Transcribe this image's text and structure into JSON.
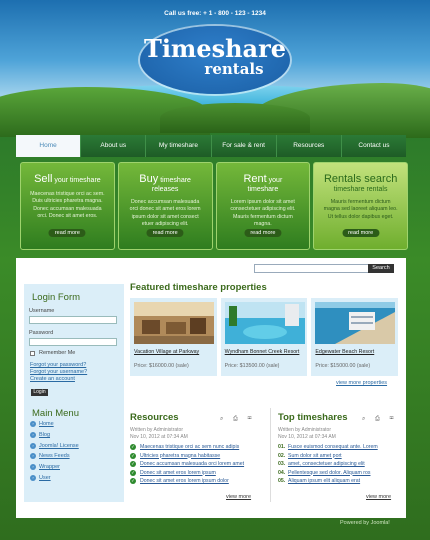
{
  "header": {
    "phone": "Call us free: + 1 - 800 - 123 - 1234",
    "logo_line1": "Timeshare",
    "logo_line2": "rentals"
  },
  "nav": {
    "items": [
      {
        "label": "Home"
      },
      {
        "label": "About us"
      },
      {
        "label": "My timeshare"
      },
      {
        "label": "For sale & rent"
      },
      {
        "label": "Resources"
      },
      {
        "label": "Contact us"
      }
    ]
  },
  "features": [
    {
      "title": "Sell",
      "title_small": " your timeshare",
      "subtitle": "",
      "text": "Maecenas tristique orci ac sem. Duis ultricies pharetra magna. Donec accumsan malesuada orci. Donec sit amet eros.",
      "button": "read more"
    },
    {
      "title": "Buy",
      "title_small": " timeshare",
      "subtitle": "releases",
      "text": "Donec accumsan malesuada orci donec sit amet eros lorem ipsum dolor sit amet consect etuer adipiscing elit.",
      "button": "read more"
    },
    {
      "title": "Rent",
      "title_small": " your",
      "subtitle": "timeshare",
      "text": "Lorem ipsum dolor sit amet consectetuer adipiscing elit. Mauris fermentum dictum magna.",
      "button": "read more"
    },
    {
      "title": "Rentals search",
      "title_small": "",
      "subtitle": "timeshare rentals",
      "text": "Mauris fermentum dictum magna sed laoreet aliquam leo. Ut tellus dolor dapibus eget.",
      "button": "read more"
    }
  ],
  "search": {
    "placeholder": "",
    "button": "Search"
  },
  "login": {
    "title": "Login Form",
    "username_label": "Username",
    "password_label": "Password",
    "remember_label": "Remember Me",
    "forgot_password": "Forgot your password?",
    "forgot_username": "Forgot your username?",
    "create_account": "Create an account",
    "button": "Login"
  },
  "main_menu": {
    "title": "Main Menu",
    "items": [
      "Home",
      "Blog",
      "Joomla! License",
      "News Feeds",
      "Wrapper",
      "User"
    ]
  },
  "featured": {
    "title": "Featured timeshare properties",
    "properties": [
      {
        "name": "Vacation Village at Parkway",
        "price": "Price: $16000.00 (sale)"
      },
      {
        "name": "Wyndham Bonnet Creek Resort",
        "price": "Price: $13500.00 (sale)"
      },
      {
        "name": "Edgewater Beach Resort",
        "price": "Price: $15000.00 (sale)"
      }
    ],
    "view_more": "view more properties"
  },
  "resources": {
    "title": "Resources",
    "icons": "⌕ ⎙ ✉",
    "meta_author": "Written by Administrator",
    "meta_date": "Nov 10, 2012 at 07:34 AM",
    "items": [
      "Maecenas tristique orci ac sem nunc adipis",
      "Ultricies pharetra magna habitasse",
      "Donec accumsan malesuada orci lorem amet",
      "Donec sit amet eros lorem ipsum",
      "Donec sit amet eros lorem ipsum dolor"
    ],
    "view_more": "view more"
  },
  "top_timeshares": {
    "title": "Top timeshares",
    "icons": "⌕ ⎙ ✉",
    "meta_author": "Written by Administrator",
    "meta_date": "Nov 10, 2012 at 07:34 AM",
    "items": [
      {
        "num": "01.",
        "text": "Fusce euismod consequat ante. Lorem"
      },
      {
        "num": "02.",
        "text": "Sum dolor sit amet port"
      },
      {
        "num": "03.",
        "text": "amet, consectetuer adipiscing elit"
      },
      {
        "num": "04.",
        "text": "Pellentesque sed dolor. Aliquam ros"
      },
      {
        "num": "05.",
        "text": "Aliquam ipsum elit aliquam erat"
      }
    ],
    "view_more": "view more"
  },
  "footer": {
    "powered": "Powered by Joomla!"
  }
}
